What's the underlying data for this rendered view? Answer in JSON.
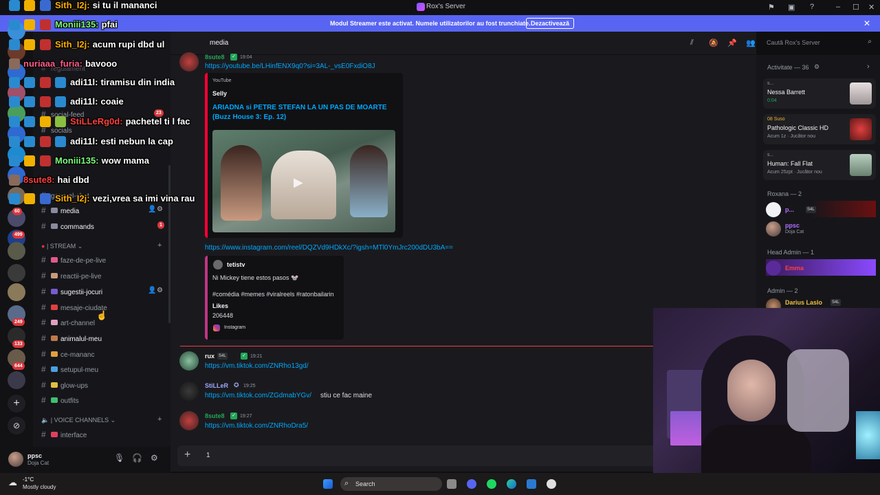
{
  "window": {
    "title": "Rox's Server"
  },
  "banner": {
    "message": "Modul Streamer este activat. Numele utilizatorilor au fost trunchiate.",
    "button": "Dezactivează",
    "accent": "#5865f2"
  },
  "server_badges": [
    "60",
    "499",
    "249",
    "133",
    "644"
  ],
  "channels": {
    "overlapped": [
      "regulament",
      "social-feed",
      "socials",
      "general-chat"
    ],
    "social_feed_badge": "23",
    "items": [
      {
        "name": "media",
        "active": true
      },
      {
        "name": "commands",
        "badge": "1",
        "active": true
      }
    ],
    "stream_category": "| STREAM",
    "stream": [
      {
        "name": "faze-de-pe-live"
      },
      {
        "name": "reactii-pe-live"
      },
      {
        "name": "sugestii-jocuri",
        "active": true
      },
      {
        "name": "mesaje-ciudate"
      },
      {
        "name": "art-channel"
      },
      {
        "name": "animalul-meu",
        "active": true
      },
      {
        "name": "ce-mananc"
      },
      {
        "name": "setupul-meu"
      },
      {
        "name": "glow-ups"
      },
      {
        "name": "outfits"
      }
    ],
    "voice_category": "| VOICE CHANNELS",
    "voice": [
      {
        "name": "interface"
      }
    ]
  },
  "user_panel": {
    "name": "ppsc",
    "status": "Doja Cat"
  },
  "chat": {
    "channel": "media",
    "search_placeholder": "Caută Rox's Server",
    "messages": [
      {
        "user": "8sute8",
        "time": "19:04",
        "link": "https://youtube.be/LHinfENX9q0?si=3AL-_vsE0FxdiO8J",
        "embed": {
          "source": "YouTube",
          "author": "Selly",
          "title": "ARIADNA si PETRE STEFAN LA UN PAS DE MOARTE",
          "subtitle": "(Buzz House 3: Ep. 12)"
        }
      },
      {
        "link": "https://www.instagram.com/reel/DQZVd9HDkXc/?igsh=MTl0YmJrc200dDU3bA==",
        "embed": {
          "author": "tetistv",
          "text": "Ni Mickey tiene estos pasos 🐭",
          "tags": "#comédia #memes #viralreels #ratonbailarin",
          "likes_label": "Likes",
          "likes": "206448",
          "source": "Instagram"
        }
      },
      {
        "user": "rux",
        "tag": "S4L",
        "time": "19:21",
        "link": "https://vm.tiktok.com/ZNRho13gd/"
      },
      {
        "user": "StiLLeR",
        "time": "19:25",
        "link": "https://vm.tiktok.com/ZGdmabYGv/",
        "text": "stiu ce fac maine"
      },
      {
        "user": "8sute8",
        "time": "19:27",
        "link": "https://vm.tiktok.com/ZNRhoDra5/"
      }
    ],
    "composer_value": "1"
  },
  "members": {
    "activity_header": "Activitate — 36",
    "activities": [
      {
        "line1": "s...",
        "line2": "Nessa Barrett",
        "line3": "0:04"
      },
      {
        "line1": "08 Suso",
        "line2": "Pathologic Classic HD",
        "line3": "Acum 1z · Jucător nou"
      },
      {
        "line1": "s...",
        "line2": "Human: Fall Flat",
        "line3": "Acum 25zpt · Jucător nou"
      }
    ],
    "roxana_header": "Roxana — 2",
    "roxana": [
      {
        "name": "p...",
        "tag": "S4L"
      },
      {
        "name": "ppsc",
        "status": "Doja Cat"
      }
    ],
    "head_admin_header": "Head Admin — 1",
    "head_admin": [
      {
        "name": "Emma"
      }
    ],
    "admin_header": "Admin — 2",
    "admin": [
      {
        "name": "Darius Laslo",
        "tag": "S4L"
      }
    ]
  },
  "overlay_chat": [
    {
      "user": "Sith_I2j:",
      "msg": "si tu il mananci",
      "color": "#ffb000"
    },
    {
      "user": "Moniii135:",
      "msg": "pfai",
      "color": "#7cfc7c"
    },
    {
      "user": "Sith_I2j:",
      "msg": "acum rupi dbd ul",
      "color": "#ffb000"
    },
    {
      "user": "nuriaaa_furia:",
      "msg": "bavooo",
      "color": "#ff5c8a"
    },
    {
      "user": "adi11l:",
      "msg": "tiramisu din india",
      "color": "#ffffff"
    },
    {
      "user": "adi11l:",
      "msg": "coaie",
      "color": "#ffffff"
    },
    {
      "user": "StiLLeRg0d:",
      "msg": "pachetel ti l fac",
      "color": "#ff4040"
    },
    {
      "user": "adi11l:",
      "msg": "esti nebun la cap",
      "color": "#ffffff"
    },
    {
      "user": "Moniii135:",
      "msg": "wow mama",
      "color": "#7cfc7c"
    },
    {
      "user": "8sute8:",
      "msg": "hai dbd",
      "color": "#ff4040"
    },
    {
      "user": "Sith_I2j:",
      "msg": "vezi,vrea sa imi vina rau",
      "color": "#ffb000"
    }
  ],
  "taskbar": {
    "temperature": "-1°C",
    "weather": "Mostly cloudy",
    "search": "Search"
  }
}
